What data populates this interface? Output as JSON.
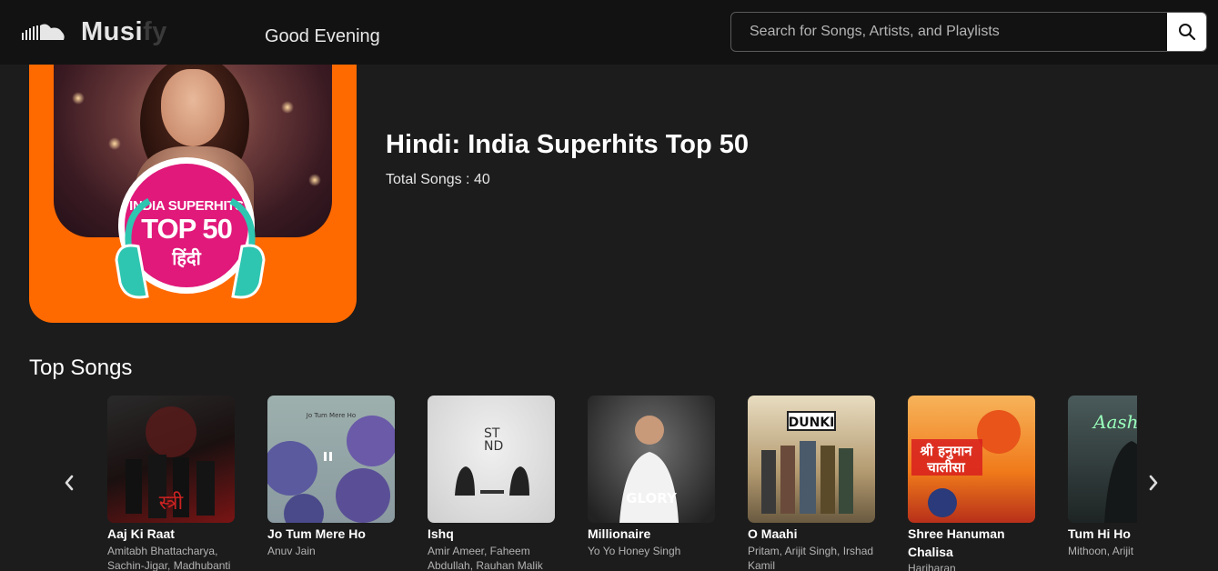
{
  "app": {
    "logo_part_1": "Musi",
    "logo_part_2": "fy",
    "logo_icon": "soundcloud-cloud-icon",
    "greeting": "Good Evening"
  },
  "search": {
    "placeholder": "Search for Songs, Artists, and Playlists",
    "value": "",
    "icon": "search-icon"
  },
  "playlist": {
    "title": "Hindi: India Superhits Top 50",
    "total_songs_text": "Total Songs : 40",
    "cover_badge_line_1": "INDIA SUPERHITS",
    "cover_badge_line_2": "TOP 50",
    "cover_badge_line_3": "हिंदी"
  },
  "top_songs": {
    "heading": "Top Songs",
    "prev_icon": "chevron-left-icon",
    "next_icon": "chevron-right-icon",
    "songs": [
      {
        "title": "Aaj Ki Raat",
        "artist": "Amitabh Bhattacharya, Sachin-Jigar, Madhubanti",
        "art_colors": [
          "#1a1a1a",
          "#8a1a1a"
        ]
      },
      {
        "title": "Jo Tum Mere Ho",
        "artist": "Anuv Jain",
        "art_colors": [
          "#8fa5a8",
          "#5a5f9a"
        ]
      },
      {
        "title": "Ishq",
        "artist": "Amir Ameer, Faheem Abdullah, Rauhan Malik",
        "art_colors": [
          "#e8e8e8",
          "#2a2a2a"
        ]
      },
      {
        "title": "Millionaire",
        "artist": "Yo Yo Honey Singh",
        "art_colors": [
          "#6a6a6a",
          "#1a1a1a"
        ]
      },
      {
        "title": "O Maahi",
        "artist": "Pritam, Arijit Singh, Irshad Kamil",
        "art_colors": [
          "#c9b48a",
          "#5a4a3a"
        ]
      },
      {
        "title": "Shree Hanuman Chalisa",
        "artist": "Hariharan",
        "art_colors": [
          "#f28a1a",
          "#c0281a"
        ]
      },
      {
        "title": "Tum Hi Ho",
        "artist": "Mithoon, Arijit Singh",
        "art_colors": [
          "#3a4a4a",
          "#1a2020"
        ]
      }
    ]
  }
}
